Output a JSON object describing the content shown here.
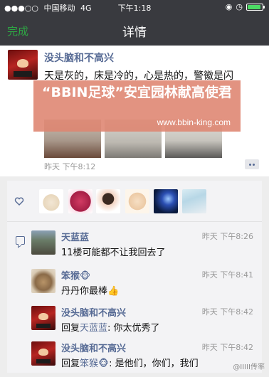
{
  "status_bar": {
    "carrier": "中国移动",
    "network": "4G",
    "time": "下午1:18",
    "battery_level": 0.9
  },
  "navbar": {
    "done_label": "完成",
    "title": "详情"
  },
  "post": {
    "author": "没头脑和不高兴",
    "text": "天是灰的，床是冷的，心是热的，警徽是闪",
    "time": "昨天 下午8:12",
    "photo_count": 3
  },
  "banner": {
    "headline": "“BBIN足球”安宜园林献高使君",
    "url": "www.bbin-king.com"
  },
  "likes": {
    "count": 6
  },
  "comments": [
    {
      "author": "天蓝蓝",
      "time": "昨天 下午8:26",
      "text": "11楼可能都不让我回去了"
    },
    {
      "author": "笨猴",
      "author_emoji": "🐵",
      "time": "昨天 下午8:41",
      "text": "丹丹你最棒👍"
    },
    {
      "author": "没头脑和不高兴",
      "time": "昨天 下午8:42",
      "reply_prefix": "回复",
      "reply_to": "天蓝蓝",
      "text": ": 你太优秀了"
    },
    {
      "author": "没头脑和不高兴",
      "time": "昨天 下午8:42",
      "reply_prefix": "回复",
      "reply_to": "笨猴🐵",
      "text": ": 是他们，你们，我们"
    }
  ],
  "watermark": "@IIIII传率",
  "colors": {
    "bar_bg": "#393a3f",
    "accent_green": "#2ea844",
    "link_blue": "#576b95",
    "banner_bg": "#de8470"
  }
}
